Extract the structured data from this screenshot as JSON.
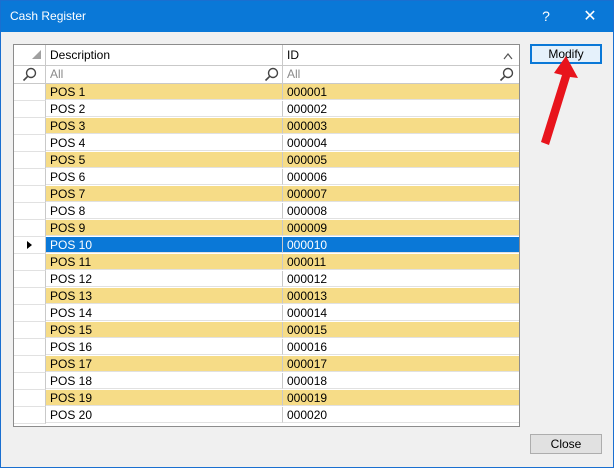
{
  "window": {
    "title": "Cash Register",
    "help_glyph": "?",
    "close_glyph": "✕"
  },
  "grid": {
    "columns": [
      "Description",
      "ID"
    ],
    "filter_placeholders": [
      "All",
      "All"
    ],
    "selected_row_index": 9,
    "rows": [
      {
        "description": "POS 1",
        "id": "000001"
      },
      {
        "description": "POS 2",
        "id": "000002"
      },
      {
        "description": "POS 3",
        "id": "000003"
      },
      {
        "description": "POS 4",
        "id": "000004"
      },
      {
        "description": "POS 5",
        "id": "000005"
      },
      {
        "description": "POS 6",
        "id": "000006"
      },
      {
        "description": "POS 7",
        "id": "000007"
      },
      {
        "description": "POS 8",
        "id": "000008"
      },
      {
        "description": "POS 9",
        "id": "000009"
      },
      {
        "description": "POS 10",
        "id": "000010"
      },
      {
        "description": "POS 11",
        "id": "000011"
      },
      {
        "description": "POS 12",
        "id": "000012"
      },
      {
        "description": "POS 13",
        "id": "000013"
      },
      {
        "description": "POS 14",
        "id": "000014"
      },
      {
        "description": "POS 15",
        "id": "000015"
      },
      {
        "description": "POS 16",
        "id": "000016"
      },
      {
        "description": "POS 17",
        "id": "000017"
      },
      {
        "description": "POS 18",
        "id": "000018"
      },
      {
        "description": "POS 19",
        "id": "000019"
      },
      {
        "description": "POS 20",
        "id": "000020"
      }
    ]
  },
  "buttons": {
    "modify": "Modify",
    "close": "Close"
  },
  "colors": {
    "titlebar": "#0a78d7",
    "row_alt": "#f6dc87",
    "selection": "#0a78d7",
    "annotation_arrow": "#e8141c"
  },
  "icons": {
    "filter": "magnifier-icon",
    "sort": "sort-arrow-icon",
    "row_indicator": "current-row-arrow-icon"
  }
}
